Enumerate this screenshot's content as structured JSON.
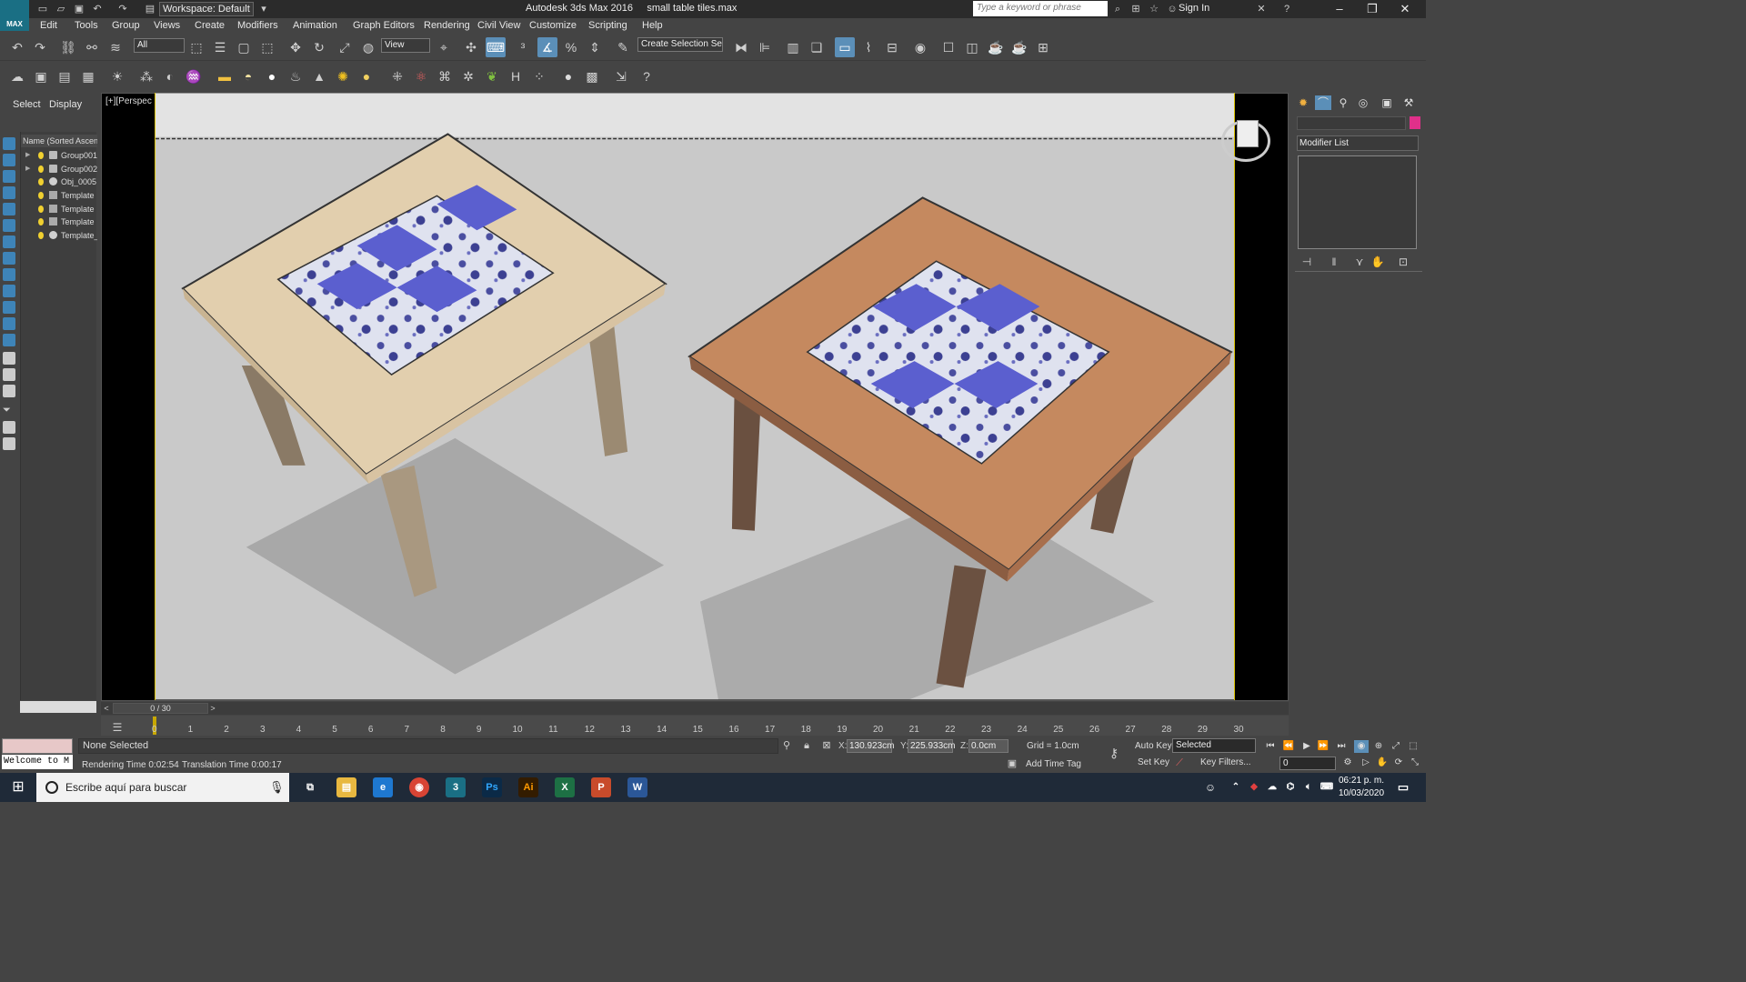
{
  "app": {
    "logo_text": "MAX",
    "title": "Autodesk 3ds Max 2016",
    "file_name": "small table tiles.max",
    "workspace": "Workspace: Default",
    "search_placeholder": "Type a keyword or phrase",
    "sign_in": "Sign In"
  },
  "menu": [
    "Edit",
    "Tools",
    "Group",
    "Views",
    "Create",
    "Modifiers",
    "Animation",
    "Graph Editors",
    "Rendering",
    "Civil View",
    "Customize",
    "Scripting",
    "Help"
  ],
  "toolbar": {
    "selection_filter": "All",
    "ref_coord": "View",
    "named_selection": "Create Selection Se"
  },
  "scene_explorer": {
    "tabs": [
      "Select",
      "Display"
    ],
    "header": "Name (Sorted Ascen",
    "items": [
      {
        "label": "Group001",
        "expandable": true
      },
      {
        "label": "Group002",
        "expandable": true
      },
      {
        "label": "Obj_0005",
        "expandable": false
      },
      {
        "label": "Template",
        "expandable": false
      },
      {
        "label": "Template",
        "expandable": false
      },
      {
        "label": "Template",
        "expandable": false
      },
      {
        "label": "Template_",
        "expandable": false
      }
    ]
  },
  "viewport": {
    "label": "[+][Perspec"
  },
  "command_panel": {
    "modifier_list": "Modifier List",
    "object_color": "#e0308a"
  },
  "timeline": {
    "current": "0 / 30",
    "ticks": [
      "0",
      "1",
      "2",
      "3",
      "4",
      "5",
      "6",
      "7",
      "8",
      "9",
      "10",
      "11",
      "12",
      "13",
      "14",
      "15",
      "16",
      "17",
      "18",
      "19",
      "20",
      "21",
      "22",
      "23",
      "24",
      "25",
      "26",
      "27",
      "28",
      "29",
      "30"
    ]
  },
  "status": {
    "selection": "None Selected",
    "render_time": "Rendering Time  0:02:54",
    "translation_time": "Translation Time  0:00:17",
    "welcome": "Welcome to M",
    "x_label": "X:",
    "x_value": "130.923cm",
    "y_label": "Y:",
    "y_value": "225.933cm",
    "z_label": "Z:",
    "z_value": "0.0cm",
    "grid": "Grid = 1.0cm",
    "add_time_tag": "Add Time Tag",
    "auto_key": "Auto Key",
    "set_key": "Set Key",
    "key_mode": "Selected",
    "key_filters": "Key Filters...",
    "frame": "0"
  },
  "taskbar": {
    "search_placeholder": "Escribe aquí para buscar",
    "time": "06:21 p. m.",
    "date": "10/03/2020",
    "apps": [
      "file-explorer",
      "edge",
      "chrome",
      "3ds-max",
      "photoshop",
      "illustrator",
      "excel",
      "powerpoint",
      "word"
    ]
  }
}
